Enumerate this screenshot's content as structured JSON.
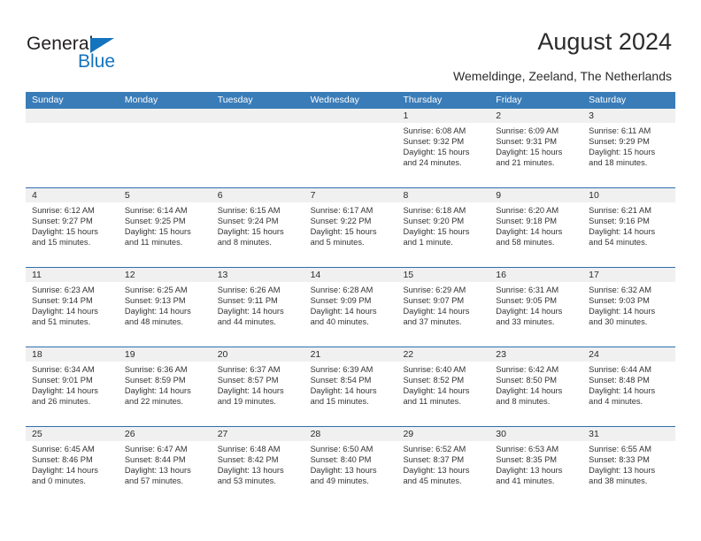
{
  "brand": {
    "name_part1": "General",
    "name_part2": "Blue",
    "accent_color": "#1473bd"
  },
  "header": {
    "title": "August 2024",
    "subtitle": "Wemeldinge, Zeeland, The Netherlands",
    "header_bg_color": "#3a7cb8",
    "daynum_bg_color": "#f0f0f0"
  },
  "calendar": {
    "day_names": [
      "Sunday",
      "Monday",
      "Tuesday",
      "Wednesday",
      "Thursday",
      "Friday",
      "Saturday"
    ],
    "weeks": [
      [
        {
          "day": "",
          "sunrise": "",
          "sunset": "",
          "daylight_line1": "",
          "daylight_line2": ""
        },
        {
          "day": "",
          "sunrise": "",
          "sunset": "",
          "daylight_line1": "",
          "daylight_line2": ""
        },
        {
          "day": "",
          "sunrise": "",
          "sunset": "",
          "daylight_line1": "",
          "daylight_line2": ""
        },
        {
          "day": "",
          "sunrise": "",
          "sunset": "",
          "daylight_line1": "",
          "daylight_line2": ""
        },
        {
          "day": "1",
          "sunrise": "Sunrise: 6:08 AM",
          "sunset": "Sunset: 9:32 PM",
          "daylight_line1": "Daylight: 15 hours",
          "daylight_line2": "and 24 minutes."
        },
        {
          "day": "2",
          "sunrise": "Sunrise: 6:09 AM",
          "sunset": "Sunset: 9:31 PM",
          "daylight_line1": "Daylight: 15 hours",
          "daylight_line2": "and 21 minutes."
        },
        {
          "day": "3",
          "sunrise": "Sunrise: 6:11 AM",
          "sunset": "Sunset: 9:29 PM",
          "daylight_line1": "Daylight: 15 hours",
          "daylight_line2": "and 18 minutes."
        }
      ],
      [
        {
          "day": "4",
          "sunrise": "Sunrise: 6:12 AM",
          "sunset": "Sunset: 9:27 PM",
          "daylight_line1": "Daylight: 15 hours",
          "daylight_line2": "and 15 minutes."
        },
        {
          "day": "5",
          "sunrise": "Sunrise: 6:14 AM",
          "sunset": "Sunset: 9:25 PM",
          "daylight_line1": "Daylight: 15 hours",
          "daylight_line2": "and 11 minutes."
        },
        {
          "day": "6",
          "sunrise": "Sunrise: 6:15 AM",
          "sunset": "Sunset: 9:24 PM",
          "daylight_line1": "Daylight: 15 hours",
          "daylight_line2": "and 8 minutes."
        },
        {
          "day": "7",
          "sunrise": "Sunrise: 6:17 AM",
          "sunset": "Sunset: 9:22 PM",
          "daylight_line1": "Daylight: 15 hours",
          "daylight_line2": "and 5 minutes."
        },
        {
          "day": "8",
          "sunrise": "Sunrise: 6:18 AM",
          "sunset": "Sunset: 9:20 PM",
          "daylight_line1": "Daylight: 15 hours",
          "daylight_line2": "and 1 minute."
        },
        {
          "day": "9",
          "sunrise": "Sunrise: 6:20 AM",
          "sunset": "Sunset: 9:18 PM",
          "daylight_line1": "Daylight: 14 hours",
          "daylight_line2": "and 58 minutes."
        },
        {
          "day": "10",
          "sunrise": "Sunrise: 6:21 AM",
          "sunset": "Sunset: 9:16 PM",
          "daylight_line1": "Daylight: 14 hours",
          "daylight_line2": "and 54 minutes."
        }
      ],
      [
        {
          "day": "11",
          "sunrise": "Sunrise: 6:23 AM",
          "sunset": "Sunset: 9:14 PM",
          "daylight_line1": "Daylight: 14 hours",
          "daylight_line2": "and 51 minutes."
        },
        {
          "day": "12",
          "sunrise": "Sunrise: 6:25 AM",
          "sunset": "Sunset: 9:13 PM",
          "daylight_line1": "Daylight: 14 hours",
          "daylight_line2": "and 48 minutes."
        },
        {
          "day": "13",
          "sunrise": "Sunrise: 6:26 AM",
          "sunset": "Sunset: 9:11 PM",
          "daylight_line1": "Daylight: 14 hours",
          "daylight_line2": "and 44 minutes."
        },
        {
          "day": "14",
          "sunrise": "Sunrise: 6:28 AM",
          "sunset": "Sunset: 9:09 PM",
          "daylight_line1": "Daylight: 14 hours",
          "daylight_line2": "and 40 minutes."
        },
        {
          "day": "15",
          "sunrise": "Sunrise: 6:29 AM",
          "sunset": "Sunset: 9:07 PM",
          "daylight_line1": "Daylight: 14 hours",
          "daylight_line2": "and 37 minutes."
        },
        {
          "day": "16",
          "sunrise": "Sunrise: 6:31 AM",
          "sunset": "Sunset: 9:05 PM",
          "daylight_line1": "Daylight: 14 hours",
          "daylight_line2": "and 33 minutes."
        },
        {
          "day": "17",
          "sunrise": "Sunrise: 6:32 AM",
          "sunset": "Sunset: 9:03 PM",
          "daylight_line1": "Daylight: 14 hours",
          "daylight_line2": "and 30 minutes."
        }
      ],
      [
        {
          "day": "18",
          "sunrise": "Sunrise: 6:34 AM",
          "sunset": "Sunset: 9:01 PM",
          "daylight_line1": "Daylight: 14 hours",
          "daylight_line2": "and 26 minutes."
        },
        {
          "day": "19",
          "sunrise": "Sunrise: 6:36 AM",
          "sunset": "Sunset: 8:59 PM",
          "daylight_line1": "Daylight: 14 hours",
          "daylight_line2": "and 22 minutes."
        },
        {
          "day": "20",
          "sunrise": "Sunrise: 6:37 AM",
          "sunset": "Sunset: 8:57 PM",
          "daylight_line1": "Daylight: 14 hours",
          "daylight_line2": "and 19 minutes."
        },
        {
          "day": "21",
          "sunrise": "Sunrise: 6:39 AM",
          "sunset": "Sunset: 8:54 PM",
          "daylight_line1": "Daylight: 14 hours",
          "daylight_line2": "and 15 minutes."
        },
        {
          "day": "22",
          "sunrise": "Sunrise: 6:40 AM",
          "sunset": "Sunset: 8:52 PM",
          "daylight_line1": "Daylight: 14 hours",
          "daylight_line2": "and 11 minutes."
        },
        {
          "day": "23",
          "sunrise": "Sunrise: 6:42 AM",
          "sunset": "Sunset: 8:50 PM",
          "daylight_line1": "Daylight: 14 hours",
          "daylight_line2": "and 8 minutes."
        },
        {
          "day": "24",
          "sunrise": "Sunrise: 6:44 AM",
          "sunset": "Sunset: 8:48 PM",
          "daylight_line1": "Daylight: 14 hours",
          "daylight_line2": "and 4 minutes."
        }
      ],
      [
        {
          "day": "25",
          "sunrise": "Sunrise: 6:45 AM",
          "sunset": "Sunset: 8:46 PM",
          "daylight_line1": "Daylight: 14 hours",
          "daylight_line2": "and 0 minutes."
        },
        {
          "day": "26",
          "sunrise": "Sunrise: 6:47 AM",
          "sunset": "Sunset: 8:44 PM",
          "daylight_line1": "Daylight: 13 hours",
          "daylight_line2": "and 57 minutes."
        },
        {
          "day": "27",
          "sunrise": "Sunrise: 6:48 AM",
          "sunset": "Sunset: 8:42 PM",
          "daylight_line1": "Daylight: 13 hours",
          "daylight_line2": "and 53 minutes."
        },
        {
          "day": "28",
          "sunrise": "Sunrise: 6:50 AM",
          "sunset": "Sunset: 8:40 PM",
          "daylight_line1": "Daylight: 13 hours",
          "daylight_line2": "and 49 minutes."
        },
        {
          "day": "29",
          "sunrise": "Sunrise: 6:52 AM",
          "sunset": "Sunset: 8:37 PM",
          "daylight_line1": "Daylight: 13 hours",
          "daylight_line2": "and 45 minutes."
        },
        {
          "day": "30",
          "sunrise": "Sunrise: 6:53 AM",
          "sunset": "Sunset: 8:35 PM",
          "daylight_line1": "Daylight: 13 hours",
          "daylight_line2": "and 41 minutes."
        },
        {
          "day": "31",
          "sunrise": "Sunrise: 6:55 AM",
          "sunset": "Sunset: 8:33 PM",
          "daylight_line1": "Daylight: 13 hours",
          "daylight_line2": "and 38 minutes."
        }
      ]
    ]
  }
}
